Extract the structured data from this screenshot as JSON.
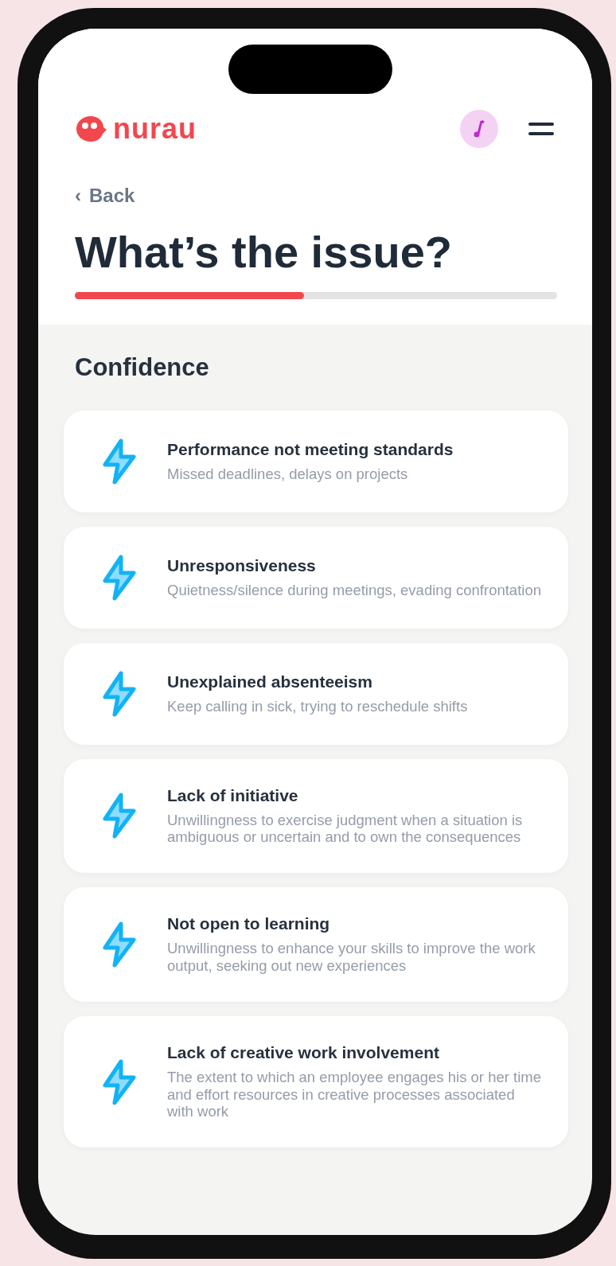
{
  "header": {
    "logo": "nurau"
  },
  "back": {
    "icon": "‹",
    "label": "Back"
  },
  "title": "What’s the issue?",
  "progress": {
    "level": 0.475
  },
  "section": "Confidence",
  "issues": [
    {
      "title": "Performance not meeting standards",
      "description": "Missed deadlines, delays on projects"
    },
    {
      "title": "Unresponsiveness",
      "description": "Quietness/silence during meetings, evading confrontation"
    },
    {
      "title": "Unexplained absenteeism",
      "description": "Keep calling in sick, trying to reschedule shifts"
    },
    {
      "title": "Lack of initiative",
      "description": "Unwillingness to exercise judgment when a situation is ambiguous or uncertain and to own the consequences"
    },
    {
      "title": "Not open to learning",
      "description": "Unwillingness to enhance your skills to improve the work output, seeking out new experiences"
    },
    {
      "title": "Lack of creative work involvement",
      "description": "The extent to which an employee engages his or her time and effort resources in creative processes associated with work"
    }
  ]
}
